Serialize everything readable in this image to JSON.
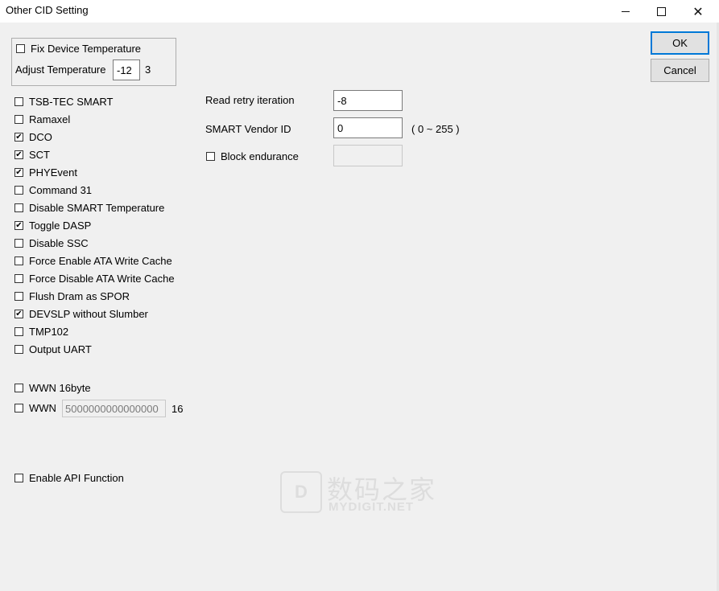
{
  "window": {
    "title": "Other CID Setting",
    "close_glyph": "✕"
  },
  "group": {
    "fix_temp_label": "Fix Device Temperature",
    "fix_temp_checked": false,
    "adjust_label": "Adjust Temperature",
    "adjust_value": "-12",
    "adjust_suffix": "3"
  },
  "options": [
    {
      "label": "TSB-TEC SMART",
      "checked": false
    },
    {
      "label": "Ramaxel",
      "checked": false
    },
    {
      "label": "DCO",
      "checked": true
    },
    {
      "label": "SCT",
      "checked": true
    },
    {
      "label": "PHYEvent",
      "checked": true
    },
    {
      "label": "Command 31",
      "checked": false
    },
    {
      "label": "Disable SMART Temperature",
      "checked": false
    },
    {
      "label": "Toggle DASP",
      "checked": true
    },
    {
      "label": "Disable SSC",
      "checked": false
    },
    {
      "label": "Force Enable  ATA Write Cache",
      "checked": false
    },
    {
      "label": "Force Disable ATA Write Cache",
      "checked": false
    },
    {
      "label": "Flush Dram as SPOR",
      "checked": false
    },
    {
      "label": "DEVSLP without Slumber",
      "checked": true
    },
    {
      "label": "TMP102",
      "checked": false
    },
    {
      "label": "Output UART",
      "checked": false
    }
  ],
  "wwn16": {
    "label": "WWN 16byte",
    "checked": false
  },
  "wwn": {
    "label": "WWN",
    "checked": false,
    "value": "5000000000000000",
    "suffix": "16"
  },
  "api": {
    "label": "Enable API Function",
    "checked": false
  },
  "right": {
    "read_retry_label": "Read retry iteration",
    "read_retry_value": "-8",
    "vendor_label": "SMART Vendor ID",
    "vendor_value": "0",
    "vendor_range": "( 0 ~ 255 )",
    "block_label": "Block endurance",
    "block_checked": false,
    "block_value": ""
  },
  "buttons": {
    "ok": "OK",
    "cancel": "Cancel"
  },
  "watermark": {
    "cn": "数码之家",
    "en": "MYDIGIT.NET",
    "logo": "D"
  },
  "check_glyph": "✔"
}
